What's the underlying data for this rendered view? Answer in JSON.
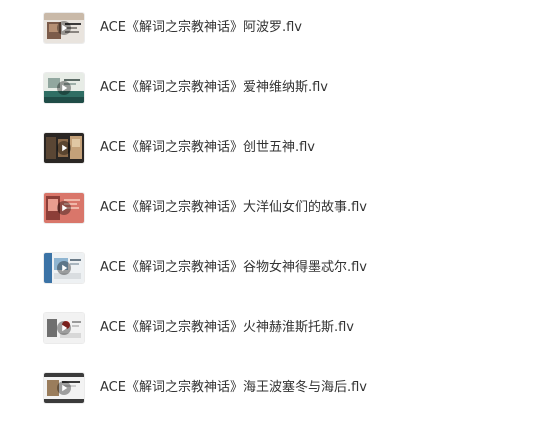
{
  "files": [
    {
      "name": "ACE《解词之宗教神话》阿波罗.flv",
      "type": "video",
      "thumbnail_palette": [
        "#e9e4de",
        "#7b5b4a",
        "#3b3a3a",
        "#c9b9a8"
      ]
    },
    {
      "name": "ACE《解词之宗教神话》爱神维纳斯.flv",
      "type": "video",
      "thumbnail_palette": [
        "#e7ece6",
        "#2f6e64",
        "#91a79f",
        "#1f4c47"
      ]
    },
    {
      "name": "ACE《解词之宗教神话》创世五神.flv",
      "type": "video",
      "thumbnail_palette": [
        "#2a2623",
        "#8b6a4a",
        "#c4a179",
        "#5a4634"
      ]
    },
    {
      "name": "ACE《解词之宗教神话》大洋仙女们的故事.flv",
      "type": "video",
      "thumbnail_palette": [
        "#d9766a",
        "#f0b7a9",
        "#8c3e38",
        "#e89d8f"
      ]
    },
    {
      "name": "ACE《解词之宗教神话》谷物女神得墨忒尔.flv",
      "type": "video",
      "thumbnail_palette": [
        "#eef1f3",
        "#3b73a6",
        "#8fb5d1",
        "#d9dde0"
      ]
    },
    {
      "name": "ACE《解词之宗教神话》火神赫淮斯托斯.flv",
      "type": "video",
      "thumbnail_palette": [
        "#f2f2f2",
        "#b8322b",
        "#6f6f6f",
        "#d8d8d8"
      ]
    },
    {
      "name": "ACE《解词之宗教神话》海王波塞冬与海后.flv",
      "type": "video",
      "thumbnail_palette": [
        "#f3f3f3",
        "#3b3b3b",
        "#9a7d5c",
        "#cfcfcf"
      ]
    }
  ],
  "icons": {
    "thumbnail_overlay": "play-icon"
  },
  "colors": {
    "text": "#333333",
    "background": "#ffffff",
    "play_overlay": "#ffffff"
  }
}
